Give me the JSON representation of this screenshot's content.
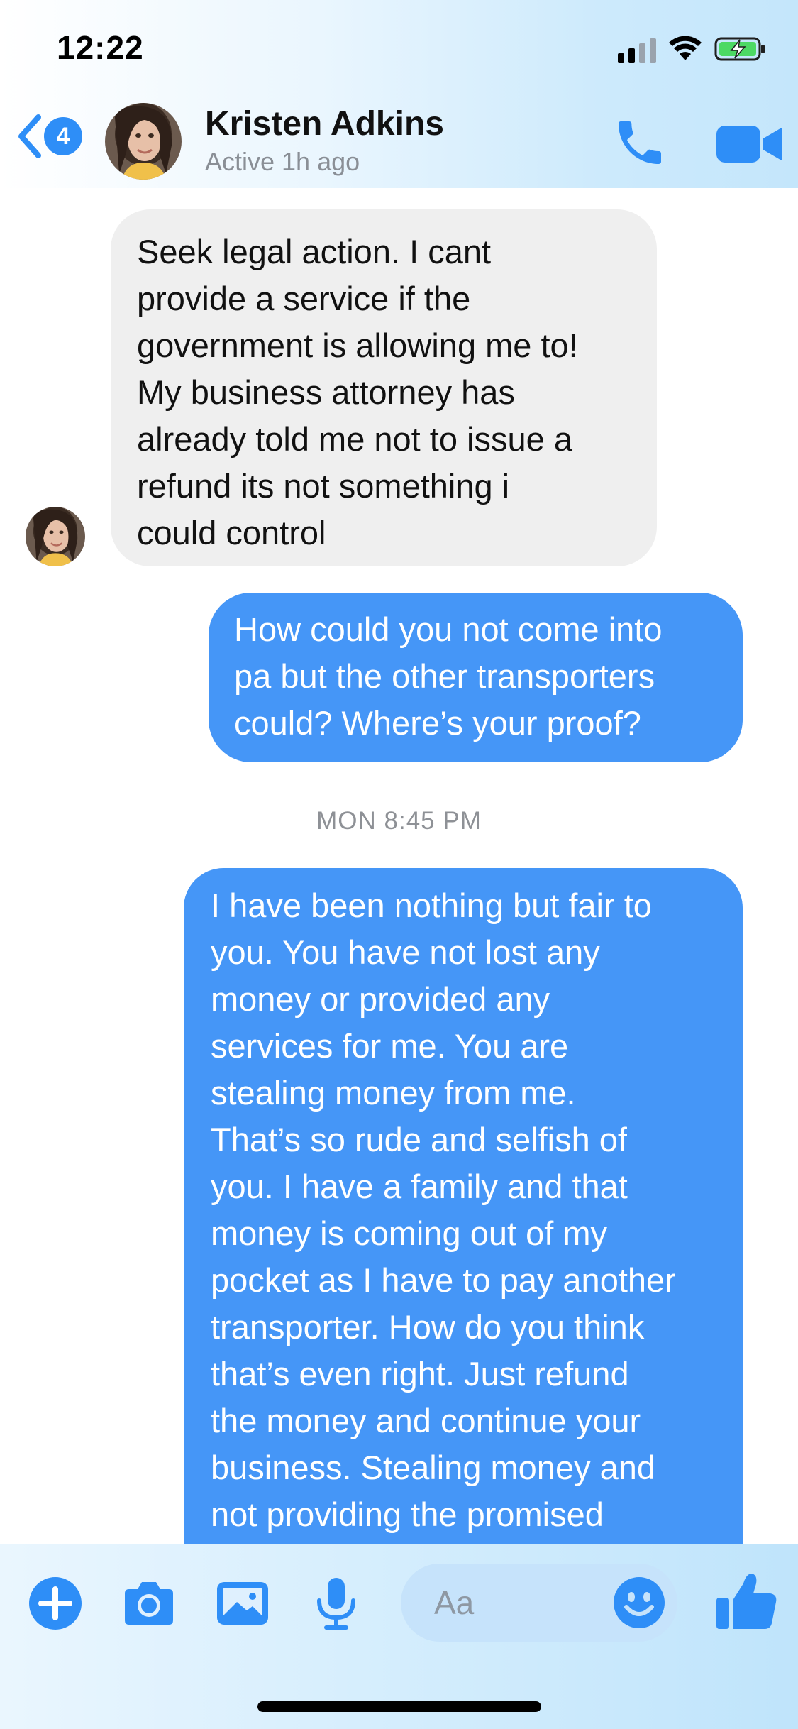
{
  "status_bar": {
    "time": "12:22",
    "icons": [
      "cellular-signal-icon",
      "wifi-icon",
      "battery-charging-icon"
    ]
  },
  "header": {
    "unread_count": "4",
    "contact_name": "Kristen Adkins",
    "contact_status": "Active 1h ago",
    "icons": [
      "back-chevron-icon",
      "phone-icon",
      "video-camera-icon"
    ]
  },
  "colors": {
    "accent": "#2e8ef7",
    "outgoing_bubble": "#4596f7",
    "incoming_bubble": "#efefef"
  },
  "messages": [
    {
      "direction": "incoming",
      "lines": [
        "Seek legal action. I cant",
        "provide a service if the",
        "government is allowing me to!",
        "My business attorney has",
        "already told me not to issue a",
        "refund its not something i",
        "could control"
      ]
    },
    {
      "direction": "outgoing",
      "lines": [
        "How could you not come into",
        "pa but the other transporters",
        "could? Where’s your proof?"
      ]
    },
    {
      "direction": "outgoing",
      "lines": [
        "I have been nothing but fair to",
        "you. You have not lost any",
        "money or provided any",
        "services for me. You are",
        "stealing money from me.",
        "That’s so rude and selfish of",
        "you. I have a family and that",
        "money is coming out of my",
        "pocket as I have to pay another",
        "transporter. How do you think",
        "that’s even right. Just refund",
        "the money and continue your",
        "business. Stealing money and",
        "not providing the promised"
      ]
    }
  ],
  "timestamp": "MON 8:45 PM",
  "composer": {
    "placeholder": "Aa",
    "icons": [
      "plus-icon",
      "camera-icon",
      "photo-icon",
      "microphone-icon",
      "emoji-icon",
      "thumbs-up-icon"
    ]
  }
}
